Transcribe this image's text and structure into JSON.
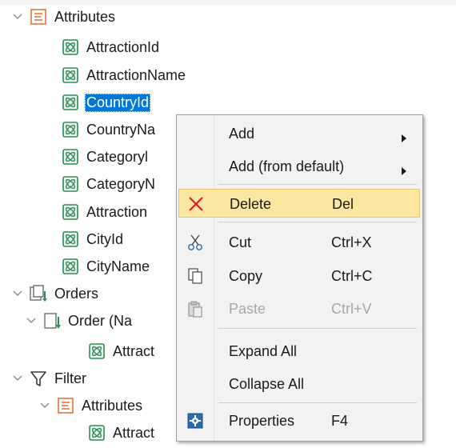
{
  "tree": {
    "attributes_label": "Attributes",
    "attribute_items": [
      "AttractionId",
      "AttractionName",
      "CountryId",
      "CountryNa",
      "Categoryl",
      "CategoryN",
      "Attraction",
      "CityId",
      "CityName"
    ],
    "orders_label": "Orders",
    "order_label": "Order (Na",
    "order_child_label": "Attract",
    "filter_label": "Filter",
    "filter_attributes_label": "Attributes",
    "filter_child_label": "Attract"
  },
  "context_menu": {
    "add": "Add",
    "add_from_default": "Add (from default)",
    "delete": "Delete",
    "delete_key": "Del",
    "cut": "Cut",
    "cut_key": "Ctrl+X",
    "copy": "Copy",
    "copy_key": "Ctrl+C",
    "paste": "Paste",
    "paste_key": "Ctrl+V",
    "expand_all": "Expand All",
    "collapse_all": "Collapse All",
    "properties": "Properties",
    "properties_key": "F4"
  },
  "colors": {
    "selection": "#0078d7",
    "menu_highlight": "#fbe7a1",
    "attribute_icon": "#2e8b57",
    "delete_icon": "#e81123",
    "folder_icon": "#e8743b"
  }
}
